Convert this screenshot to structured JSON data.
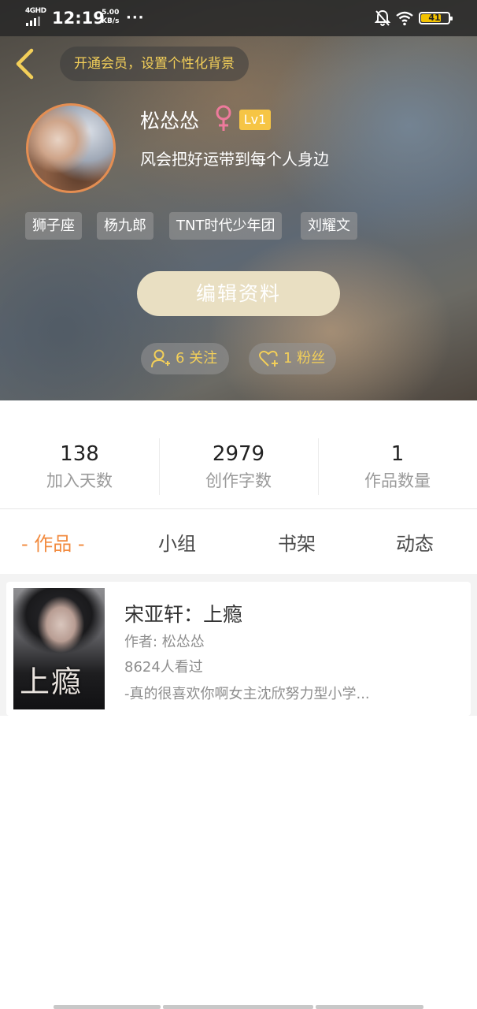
{
  "status_bar": {
    "network": "4GHD",
    "time": "12:19",
    "speed_value": "5.00",
    "speed_unit": "KB/s",
    "dots": "···",
    "battery": "41",
    "battery_color": "#f3c200"
  },
  "header": {
    "vip_prompt": "开通会员，设置个性化背景"
  },
  "profile": {
    "username": "松怂怂",
    "gender_icon": "female-icon",
    "level": "Lv1",
    "signature": "风会把好运带到每个人身边",
    "tags": [
      "狮子座",
      "杨九郎",
      "TNT时代少年团",
      "刘耀文"
    ],
    "edit_label": "编辑资料",
    "following_label": "6 关注",
    "followers_label": "1 粉丝"
  },
  "stats": [
    {
      "value": "138",
      "label": "加入天数"
    },
    {
      "value": "2979",
      "label": "创作字数"
    },
    {
      "value": "1",
      "label": "作品数量"
    }
  ],
  "tabs": [
    {
      "label": "- 作品 -",
      "active": true
    },
    {
      "label": "小组",
      "active": false
    },
    {
      "label": "书架",
      "active": false
    },
    {
      "label": "动态",
      "active": false
    }
  ],
  "works": [
    {
      "cover_text": "上瘾",
      "title": "宋亚轩：上瘾",
      "author": "作者: 松怂怂",
      "views": "8624人看过",
      "description": "-真的很喜欢你啊女主沈欣努力型小学..."
    }
  ],
  "colors": {
    "accent": "#f28a3e",
    "gold": "#f3cf59",
    "level_badge": "#f6c545",
    "avatar_ring": "#e48e52"
  }
}
